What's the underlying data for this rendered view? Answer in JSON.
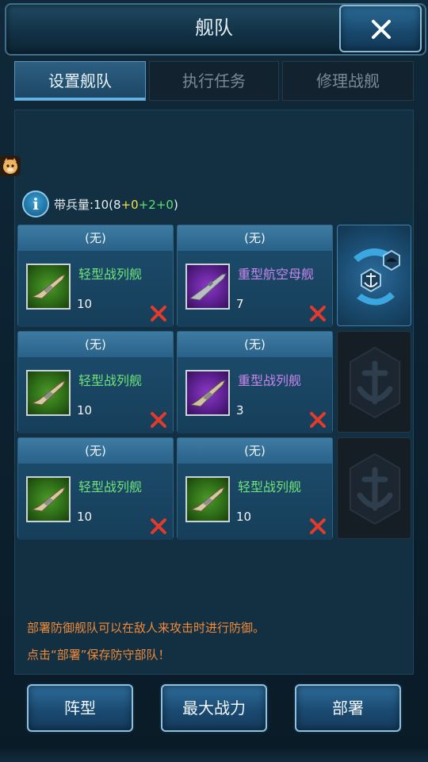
{
  "window": {
    "title": "舰队"
  },
  "tabs": [
    {
      "label": "设置舰队",
      "active": true
    },
    {
      "label": "执行任务",
      "active": false
    },
    {
      "label": "修理战舰",
      "active": false
    }
  ],
  "troops": {
    "label": "带兵量:",
    "total": "10",
    "open": "(",
    "a": "8",
    "plus1": "+",
    "b": "0",
    "plus2": "+",
    "c": "2",
    "plus3": "+",
    "d": "0",
    "close": ")"
  },
  "fleets": [
    {
      "left": {
        "header": "(无)",
        "name": "轻型战列舰",
        "count": "10",
        "color": "green",
        "icon": "light-battleship-icon"
      },
      "right": {
        "header": "(无)",
        "name": "重型航空母舰",
        "count": "7",
        "color": "purple",
        "icon": "heavy-carrier-icon"
      },
      "slot": {
        "active": true,
        "icon": "anchor-admiral-icon"
      }
    },
    {
      "left": {
        "header": "(无)",
        "name": "轻型战列舰",
        "count": "10",
        "color": "green",
        "icon": "light-battleship-icon"
      },
      "right": {
        "header": "(无)",
        "name": "重型战列舰",
        "count": "3",
        "color": "purple",
        "icon": "heavy-battleship-icon"
      },
      "slot": {
        "active": false,
        "icon": "anchor-icon"
      }
    },
    {
      "left": {
        "header": "(无)",
        "name": "轻型战列舰",
        "count": "10",
        "color": "green",
        "icon": "light-battleship-icon"
      },
      "right": {
        "header": "(无)",
        "name": "轻型战列舰",
        "count": "10",
        "color": "green",
        "icon": "light-battleship-icon"
      },
      "slot": {
        "active": false,
        "icon": "anchor-icon"
      }
    }
  ],
  "tips": {
    "line1": "部署防御舰队可以在敌人来攻击时进行防御。",
    "line2": "点击“部署”保存防守部队！"
  },
  "buttons": {
    "formation": "阵型",
    "max_power": "最大战力",
    "deploy": "部署"
  },
  "colors": {
    "light_ship_name": "#6fe37a",
    "heavy_ship_name": "#c686ec",
    "tip_text": "#f08a3c",
    "remove_x": "#e23a2c"
  }
}
